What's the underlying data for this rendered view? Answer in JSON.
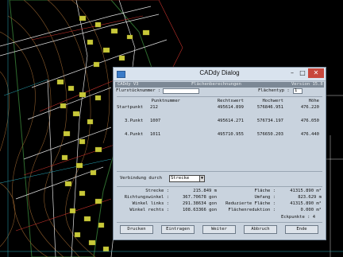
{
  "dialog": {
    "title": "CADdy Dialog",
    "window_buttons": {
      "minimize": "–",
      "maximize": "□",
      "close": "✕"
    },
    "subbar": {
      "left": "CADdy V3",
      "center": "Flächenberechnungen",
      "right": "Version 15.8"
    },
    "flurstueck_label": "Flurstücknummer :",
    "flurstueck_value": "",
    "flaechentyp_label": "Flächentyp :",
    "flaechentyp_value": "1",
    "columns": [
      "Punktnummer",
      "Rechtswert",
      "Hochwert",
      "Höhe"
    ],
    "points": [
      {
        "label": "Startpunkt",
        "nr": "212",
        "rw": "495614.899",
        "hw": "576846.951",
        "h": "476.220"
      },
      {
        "label": "3.Punkt",
        "nr": "1007",
        "rw": "495614.271",
        "hw": "576734.197",
        "h": "476.050"
      },
      {
        "label": "4.Punkt",
        "nr": "1011",
        "rw": "495710.955",
        "hw": "576650.203",
        "h": "476.440"
      }
    ],
    "connection_label": "Verbindung durch",
    "connection_value": "Strecke",
    "results_left": [
      {
        "label": "Strecke :",
        "value": "215.849 m"
      },
      {
        "label": "Richtungswinkel :",
        "value": "367.70678 gon"
      },
      {
        "label": "Winkel links :",
        "value": "291.38634 gon"
      },
      {
        "label": "Winkel rechts :",
        "value": "108.63366 gon"
      }
    ],
    "results_right": [
      {
        "label": "Fläche :",
        "value": "41315.890 m²"
      },
      {
        "label": "Umfang :",
        "value": "823.629 m"
      },
      {
        "label": "Reduzierte Fläche :",
        "value": "41315.890 m²"
      },
      {
        "label": "Flächenreduktion :",
        "value": "0.000 m²"
      }
    ],
    "eckpunkte": "Eckpunkte : 4",
    "buttons": [
      "Drucken",
      "Eintragen",
      "Weiter",
      "Abbruch",
      "Ende"
    ]
  },
  "colors": {
    "titlebar": "#d9e3ee",
    "dialog_bg": "#c9d3de",
    "close": "#c8473c",
    "cad_bg": "#000000"
  }
}
